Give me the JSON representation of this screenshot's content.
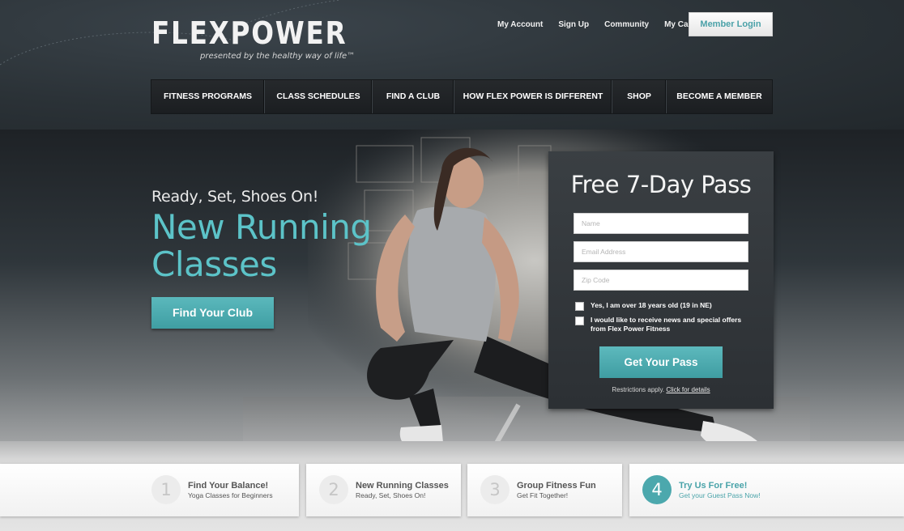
{
  "brand": {
    "logo": "FLEXPOWER",
    "tagline": "presented by the healthy way of life™"
  },
  "header": {
    "links": [
      "My Account",
      "Sign Up",
      "Community",
      "My Cart"
    ],
    "member_login": "Member Login"
  },
  "nav": {
    "items": [
      "FITNESS PROGRAMS",
      "CLASS SCHEDULES",
      "FIND A CLUB",
      "HOW FLEX POWER IS DIFFERENT",
      "SHOP",
      "BECOME A MEMBER"
    ]
  },
  "hero": {
    "kicker": "Ready, Set, Shoes On!",
    "title": "New Running Classes",
    "cta": "Find Your Club"
  },
  "pass_form": {
    "title": "Free 7-Day Pass",
    "name_placeholder": "Name",
    "email_placeholder": "Email Address",
    "zip_placeholder": "Zip Code",
    "age_check": "Yes, I am over 18 years old (19 in NE)",
    "news_check": "I would like to receive news and special offers from Flex Power Fitness",
    "submit": "Get Your Pass",
    "restrictions": "Restrictions apply.",
    "restrictions_link": "Click for details"
  },
  "features": [
    {
      "num": "1",
      "title": "Find Your Balance!",
      "sub": "Yoga Classes for Beginners"
    },
    {
      "num": "2",
      "title": "New Running Classes",
      "sub": "Ready, Set, Shoes On!"
    },
    {
      "num": "3",
      "title": "Group Fitness Fun",
      "sub": "Get Fit Together!"
    },
    {
      "num": "4",
      "title": "Try Us For Free!",
      "sub": "Get your Guest Pass Now!"
    }
  ],
  "colors": {
    "accent": "#4ca8ad",
    "dark": "#2a3035"
  }
}
